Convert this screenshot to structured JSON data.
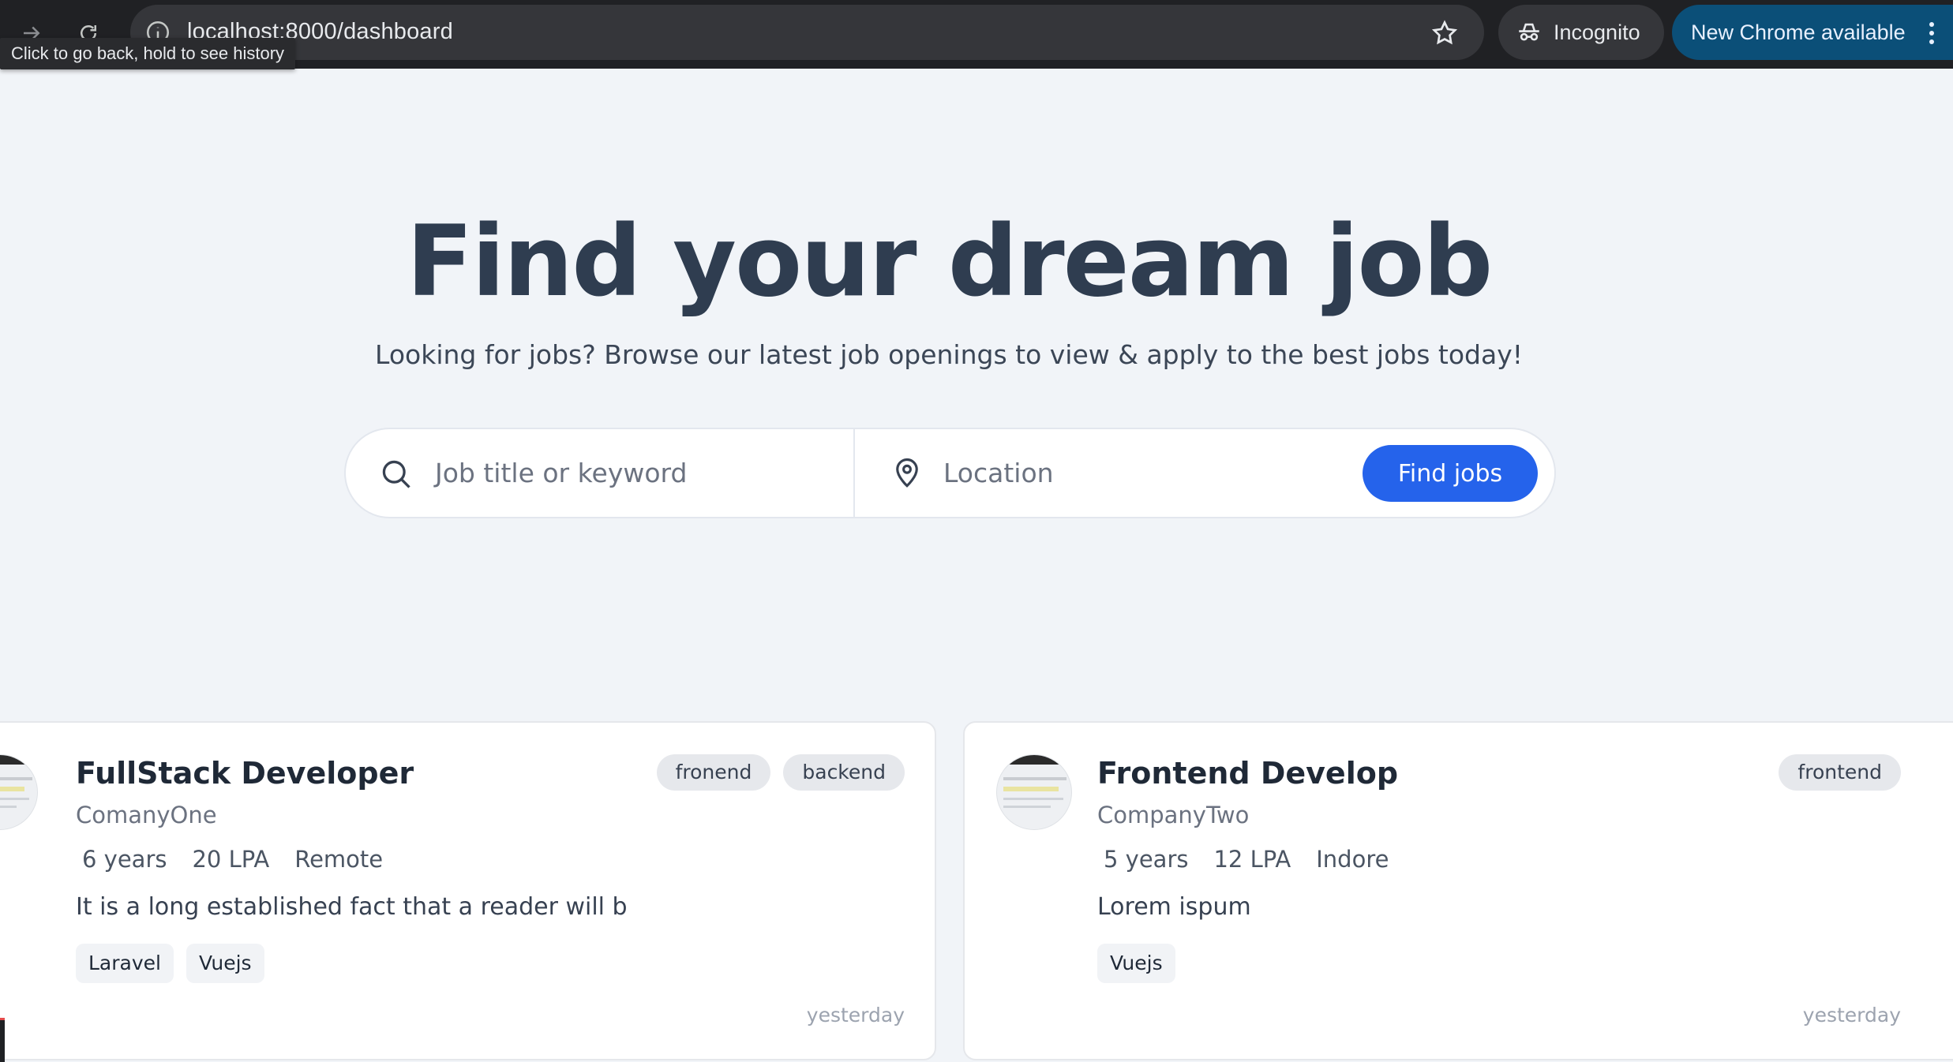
{
  "browser": {
    "url": "localhost:8000/dashboard",
    "incognito_label": "Incognito",
    "update_label": "New Chrome available",
    "tooltip": "Click to go back, hold to see history"
  },
  "hero": {
    "title": "Find your dream job",
    "subtitle": "Looking for jobs? Browse our latest job openings to view & apply to the best jobs today!"
  },
  "search": {
    "keyword_placeholder": "Job title or keyword",
    "location_placeholder": "Location",
    "button_label": "Find jobs"
  },
  "jobs": [
    {
      "title": "FullStack Developer",
      "company": "ComanyOne",
      "experience": "6 years",
      "salary": "20 LPA",
      "location": "Remote",
      "description": "It is a long established fact that a reader will b",
      "tags": [
        "fronend",
        "backend"
      ],
      "skills": [
        "Laravel",
        "Vuejs"
      ],
      "posted": "yesterday"
    },
    {
      "title": "Frontend Develop",
      "company": "CompanyTwo",
      "experience": "5 years",
      "salary": "12 LPA",
      "location": "Indore",
      "description": "Lorem ispum",
      "tags": [
        "frontend"
      ],
      "skills": [
        "Vuejs"
      ],
      "posted": "yesterday"
    }
  ],
  "colors": {
    "accent": "#2563eb",
    "heading": "#2f3d50",
    "background": "#f1f4f8"
  }
}
